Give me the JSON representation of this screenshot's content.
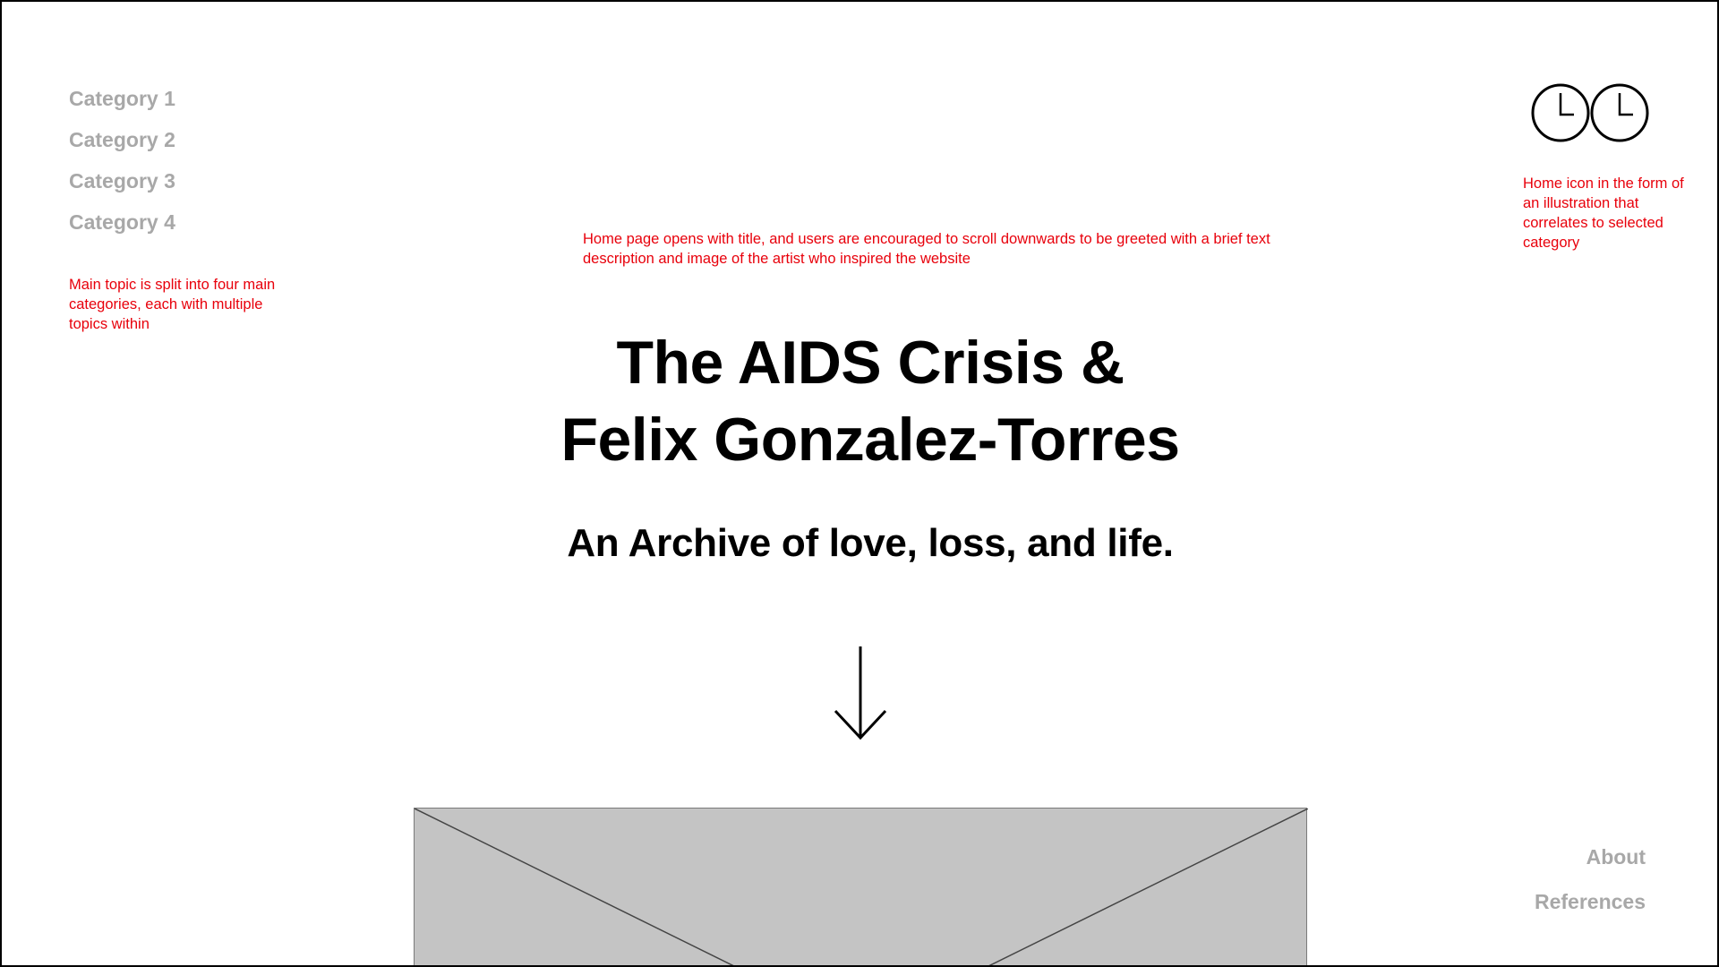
{
  "nav": {
    "categories": [
      {
        "label": "Category 1"
      },
      {
        "label": "Category 2"
      },
      {
        "label": "Category 3"
      },
      {
        "label": "Category 4"
      }
    ]
  },
  "annotations": {
    "left": "Main topic is split into four main categories, each with multiple topics within",
    "center": "Home page opens with title, and users are encouraged to scroll downwards to be greeted with a brief text description and image  of the artist who inspired the website",
    "right": "Home icon in the form of an illustration that correlates to selected category",
    "color": "#e8000b"
  },
  "hero": {
    "title_line1": "The AIDS Crisis &",
    "title_line2": "Felix Gonzalez-Torres",
    "subtitle": "An Archive of love, loss, and life."
  },
  "icons": {
    "home": "two-clocks-icon",
    "scroll": "arrow-down-icon",
    "image": "image-placeholder-icon"
  },
  "footer": {
    "about": "About",
    "references": "References"
  },
  "colors": {
    "nav_text": "#a8a8a8",
    "placeholder": "#c4c4c4",
    "text": "#000000"
  }
}
